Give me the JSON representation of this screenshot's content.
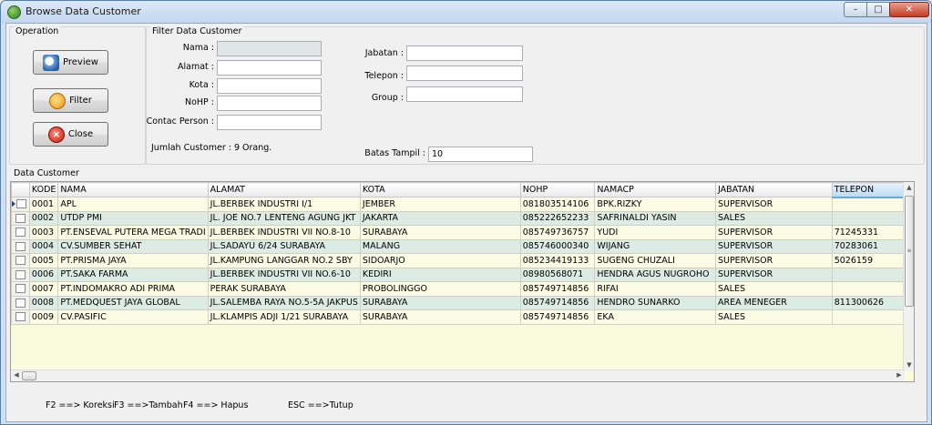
{
  "window": {
    "title": "Browse Data Customer",
    "min_glyph": "–",
    "max_glyph": "□",
    "close_glyph": "✕"
  },
  "operation": {
    "group_label": "Operation",
    "preview_label": "Preview",
    "filter_label": "Filter",
    "close_label": "Close"
  },
  "filter": {
    "group_label": "Filter Data Customer",
    "nama_label": "Nama  :",
    "alamat_label": "Alamat :",
    "kota_label": "Kota :",
    "nohp_label": "NoHP :",
    "contact_label": "Contac Person  :",
    "jabatan_label": "Jabatan :",
    "telepon_label": "Telepon :",
    "group_field_label": "Group :",
    "nama_value": "",
    "alamat_value": "",
    "kota_value": "",
    "nohp_value": "",
    "contact_value": "",
    "jabatan_value": "",
    "telepon_value": "",
    "group_value": "",
    "jumlah_text": "Jumlah Customer :  9 Orang.",
    "batas_label": "Batas Tampil :",
    "batas_value": "10"
  },
  "grid": {
    "group_label": "Data Customer",
    "columns": [
      "KODE",
      "NAMA",
      "ALAMAT",
      "KOTA",
      "NOHP",
      "NAMACP",
      "JABATAN",
      "TELEPON"
    ],
    "rows": [
      [
        "0001",
        "APL",
        "JL.BERBEK INDUSTRI I/1",
        "JEMBER",
        "081803514106",
        "BPK.RIZKY",
        "SUPERVISOR",
        ""
      ],
      [
        "0002",
        "UTDP PMI",
        "JL. JOE NO.7 LENTENG AGUNG JKT",
        "JAKARTA",
        "085222652233",
        "SAFRINALDI YASIN",
        "SALES",
        ""
      ],
      [
        "0003",
        "PT.ENSEVAL PUTERA MEGA TRADI",
        "JL.BERBEK INDUSTRI VII NO.8-10",
        "SURABAYA",
        "085749736757",
        "YUDI",
        "SUPERVISOR",
        "71245331"
      ],
      [
        "0004",
        "CV.SUMBER SEHAT",
        "JL.SADAYU 6/24 SURABAYA",
        "MALANG",
        "085746000340",
        "WIJANG",
        "SUPERVISOR",
        "70283061"
      ],
      [
        "0005",
        "PT.PRISMA JAYA",
        "JL.KAMPUNG LANGGAR NO.2 SBY",
        "SIDOARJO",
        "085234419133",
        "SUGENG CHUZALI",
        "SUPERVISOR",
        "5026159"
      ],
      [
        "0006",
        "PT.SAKA FARMA",
        "JL.BERBEK INDUSTRI VII NO.6-10",
        "KEDIRI",
        "08980568071",
        "HENDRA AGUS NUGROHO",
        "SUPERVISOR",
        ""
      ],
      [
        "0007",
        "PT.INDOMAKRO ADI PRIMA",
        "PERAK SURABAYA",
        "PROBOLINGGO",
        "085749714856",
        "RIFAI",
        "SALES",
        ""
      ],
      [
        "0008",
        "PT.MEDQUEST JAYA GLOBAL",
        "JL.SALEMBA RAYA NO.5-5A JAKPUS",
        "SURABAYA",
        "085749714856",
        "HENDRO SUNARKO",
        "AREA MENEGER",
        "811300626"
      ],
      [
        "0009",
        "CV.PASIFIC",
        "JL.KLAMPIS ADJI 1/21 SURABAYA",
        "SURABAYA",
        "085749714856",
        "EKA",
        "SALES",
        ""
      ]
    ]
  },
  "shortcuts": {
    "koreksi": "F2 ==> Koreksi",
    "tambah": "F3 ==>Tambah",
    "hapus": "F4 ==> Hapus",
    "tutup": "ESC ==>Tutup"
  }
}
